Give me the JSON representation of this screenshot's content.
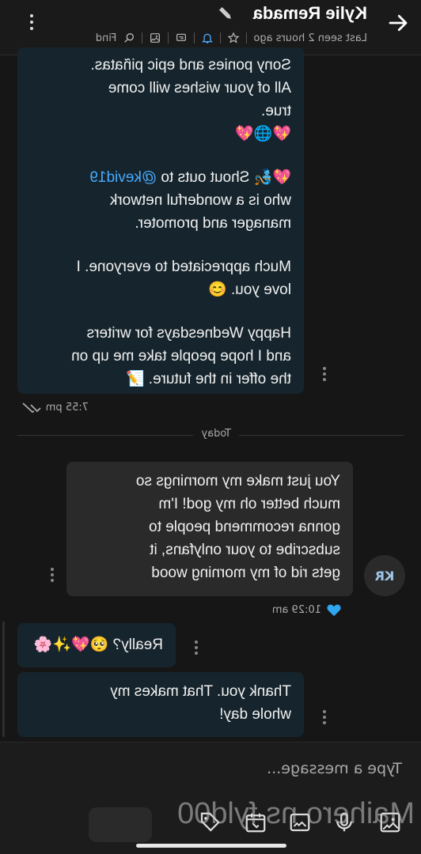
{
  "header": {
    "contact_name": "Kylie Remada",
    "status": "Last seen 2 hours ago",
    "find_label": "Find",
    "icons": [
      "back-arrow-icon",
      "edit-icon",
      "star-icon",
      "bell-icon",
      "chat-icon",
      "image-icon",
      "search-icon",
      "more-vertical-icon"
    ]
  },
  "messages": {
    "m1": {
      "text_lines": [
        "Sony ponies and epic piñatas.",
        "All of your wishes will come",
        "true.",
        "💖🌐💖"
      ]
    },
    "m2": {
      "line1": "💖🧞 Shout outs to ",
      "mention": "@kevid19",
      "line2": "who is a wonderful network",
      "line3": "manager and promoter."
    },
    "m3": {
      "line1": "Much appreciated to everyone. I",
      "line2": "love you. 😊"
    },
    "m4": {
      "line1": "Happy Wednesdays for writers",
      "line2": "and I hope people take me up on",
      "line3": "the offer in the future. 📝"
    },
    "m1_time": "7:55 pm",
    "day_separator": "Today",
    "incoming": {
      "avatar_initials": "KR",
      "lines": [
        "You just make my mornings so",
        "much better oh my god! I'm",
        "gonna recommend people to",
        "subscribe to your onlyfans, it",
        "gets rid of my morning wood"
      ],
      "time": "10:29 am",
      "reaction": "heart"
    },
    "reply1": "Really? 🥺💖✨🌸",
    "reply2_lines": [
      "Thank you. That makes my",
      "whole day!"
    ]
  },
  "composer": {
    "placeholder": "Type a message...",
    "ghost_text": "Maihero ns fyld00"
  },
  "colors": {
    "accent": "#47a9ff",
    "outgoing_bubble": "#16252d",
    "incoming_bubble": "#2a2a2a",
    "background": "#161616"
  }
}
